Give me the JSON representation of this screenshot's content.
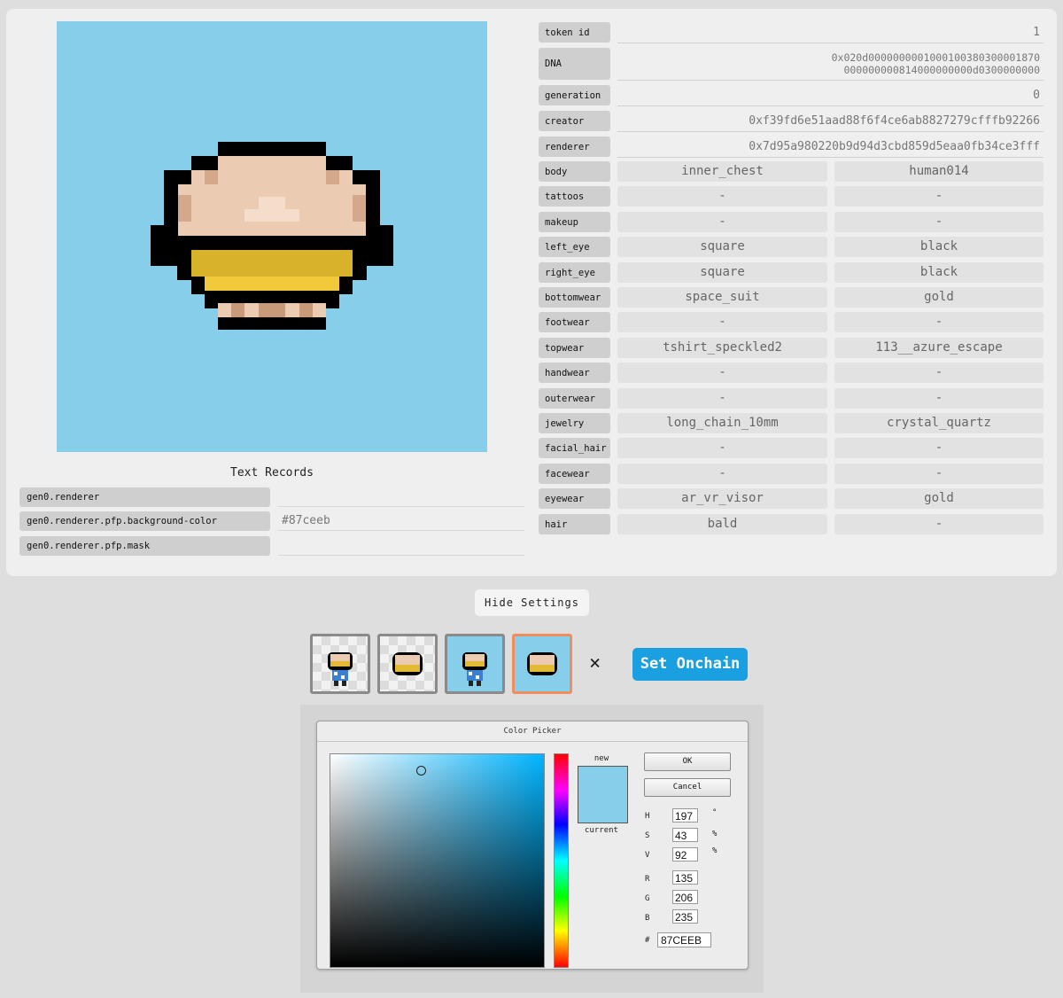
{
  "character": {
    "background_color": "#87ceeb"
  },
  "text_records": {
    "title": "Text Records",
    "rows": [
      {
        "key": "gen0.renderer",
        "value": ""
      },
      {
        "key": "gen0.renderer.pfp.background-color",
        "value": "#87ceeb"
      },
      {
        "key": "gen0.renderer.pfp.mask",
        "value": ""
      }
    ]
  },
  "token": {
    "token_id": {
      "label": "token id",
      "value": "1"
    },
    "dna": {
      "label": "DNA",
      "line1": "0x020d000000000100010038030000187​0",
      "line2": "000000000814000000000d0300000000"
    },
    "generation": {
      "label": "generation",
      "value": "0"
    },
    "creator": {
      "label": "creator",
      "value": "0xf39fd6e51aad88f6f4ce6ab8827279cfffb92266"
    },
    "renderer": {
      "label": "renderer",
      "value": "0x7d95a980220b9d94d3cbd859d5eaa0fb34ce3fff"
    }
  },
  "attributes": [
    {
      "label": "body",
      "a": "inner_chest",
      "b": "human014"
    },
    {
      "label": "tattoos",
      "a": "-",
      "b": "-"
    },
    {
      "label": "makeup",
      "a": "-",
      "b": "-"
    },
    {
      "label": "left_eye",
      "a": "square",
      "b": "black"
    },
    {
      "label": "right_eye",
      "a": "square",
      "b": "black"
    },
    {
      "label": "bottomwear",
      "a": "space_suit",
      "b": "gold"
    },
    {
      "label": "footwear",
      "a": "-",
      "b": "-"
    },
    {
      "label": "topwear",
      "a": "tshirt_speckled2",
      "b": "113__azure_escape"
    },
    {
      "label": "handwear",
      "a": "-",
      "b": "-"
    },
    {
      "label": "outerwear",
      "a": "-",
      "b": "-"
    },
    {
      "label": "jewelry",
      "a": "long_chain_10mm",
      "b": "crystal_quartz"
    },
    {
      "label": "facial_hair",
      "a": "-",
      "b": "-"
    },
    {
      "label": "facewear",
      "a": "-",
      "b": "-"
    },
    {
      "label": "eyewear",
      "a": "ar_vr_visor",
      "b": "gold"
    },
    {
      "label": "hair",
      "a": "bald",
      "b": "-"
    }
  ],
  "controls": {
    "hide_settings": "Hide Settings",
    "close_symbol": "×",
    "set_onchain": "Set Onchain",
    "thumbnails": [
      {
        "name": "full-body-transparent",
        "selected": false
      },
      {
        "name": "head-transparent",
        "selected": false
      },
      {
        "name": "full-body-background",
        "selected": false
      },
      {
        "name": "head-background",
        "selected": true
      }
    ]
  },
  "color_picker": {
    "title": "Color Picker",
    "new_label": "new",
    "current_label": "current",
    "ok": "OK",
    "cancel": "Cancel",
    "h_label": "H",
    "h": "197",
    "h_unit": "°",
    "s_label": "S",
    "s": "43",
    "s_unit": "%",
    "v_label": "V",
    "v": "92",
    "v_unit": "%",
    "r_label": "R",
    "r": "135",
    "g_label": "G",
    "g": "206",
    "b_label": "B",
    "b": "235",
    "hex_label": "#",
    "hex": "87CEEB",
    "accent": "#87ceeb"
  }
}
